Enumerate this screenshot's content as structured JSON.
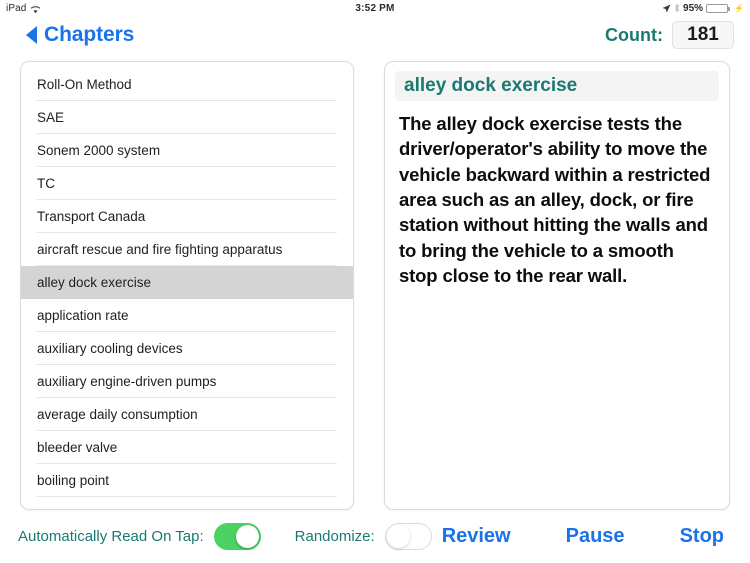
{
  "status_bar": {
    "device": "iPad",
    "wifi_icon": "wifi-icon",
    "time": "3:52 PM",
    "location_icon": "location-arrow-icon",
    "bluetooth_icon": "bluetooth-icon",
    "battery_percent": "95%",
    "battery_icon": "battery-icon",
    "charging_icon": "charging-plug-icon",
    "battery_level": 95
  },
  "navbar": {
    "back_icon": "back-chevron-icon",
    "back_label": "Chapters",
    "count_label": "Count:",
    "count_value": "181"
  },
  "colors": {
    "accent_blue": "#1a73e8",
    "accent_teal": "#1a7a72",
    "switch_on_green": "#4cd263",
    "selected_row": "#d4d4d4",
    "battery_green": "#3dd35f"
  },
  "list": {
    "selected_index": 6,
    "items": [
      {
        "label": "Roll-On Method"
      },
      {
        "label": "SAE"
      },
      {
        "label": "Sonem 2000 system"
      },
      {
        "label": "TC"
      },
      {
        "label": "Transport Canada"
      },
      {
        "label": "aircraft rescue and fire fighting apparatus"
      },
      {
        "label": "alley dock exercise"
      },
      {
        "label": "application rate"
      },
      {
        "label": "auxiliary cooling devices"
      },
      {
        "label": "auxiliary engine-driven pumps"
      },
      {
        "label": "average daily consumption"
      },
      {
        "label": "bleeder valve"
      },
      {
        "label": "boiling point"
      }
    ]
  },
  "detail": {
    "title": "alley dock exercise",
    "body": "The alley dock exercise tests the driver/operator's ability to move the vehicle backward within a restricted area such as an alley, dock, or fire station without hitting the walls and to bring the vehicle to a smooth stop close to the rear wall."
  },
  "toolbar": {
    "auto_read_label": "Automatically Read On Tap:",
    "auto_read_on": true,
    "randomize_label": "Randomize:",
    "randomize_on": false,
    "review_label": "Review",
    "pause_label": "Pause",
    "stop_label": "Stop"
  }
}
